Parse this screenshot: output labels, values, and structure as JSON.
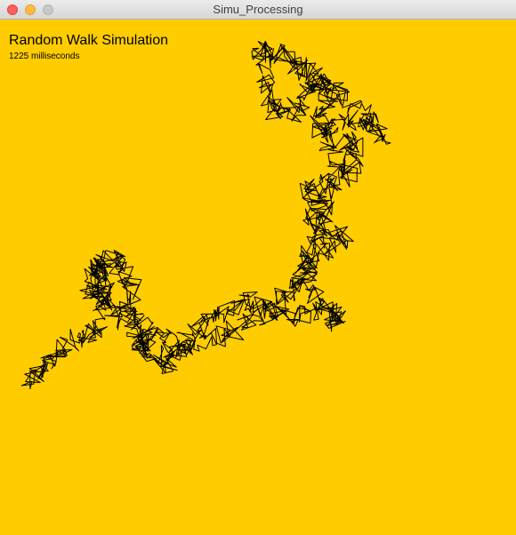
{
  "window": {
    "title": "Simu_Processing",
    "controls": [
      "close",
      "minimize",
      "maximize"
    ],
    "background_color": "#ffcc00"
  },
  "sketch": {
    "heading": "Random Walk Simulation",
    "timing_text": "1225 milliseconds",
    "path_color": "#000000",
    "path_icon": "random-walk-path"
  }
}
